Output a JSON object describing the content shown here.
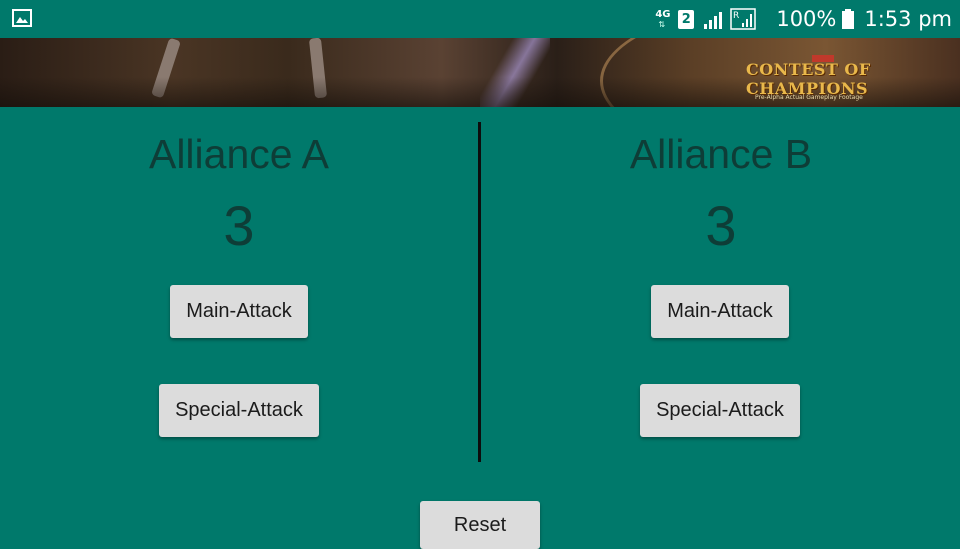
{
  "status_bar": {
    "network": "4G",
    "sim_slot": "2",
    "roaming_label": "R",
    "battery": "100%",
    "time": "1:53 pm"
  },
  "banner": {
    "logo_text": "CONTEST OF CHAMPIONS",
    "logo_subtitle": "Pre-Alpha Actual Gameplay Footage"
  },
  "alliance_a": {
    "title": "Alliance A",
    "score": "3",
    "main_attack_label": "Main-Attack",
    "special_attack_label": "Special-Attack"
  },
  "alliance_b": {
    "title": "Alliance B",
    "score": "3",
    "main_attack_label": "Main-Attack",
    "special_attack_label": "Special-Attack"
  },
  "reset_label": "Reset"
}
